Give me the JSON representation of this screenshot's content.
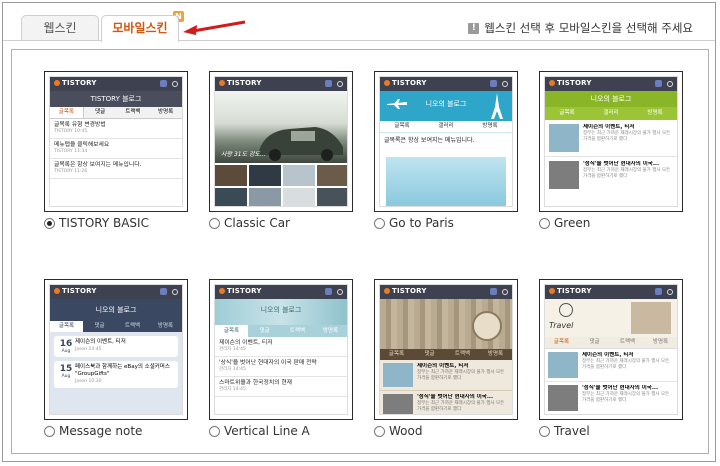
{
  "tabs": [
    {
      "label": "웹스킨",
      "active": false
    },
    {
      "label": "모바일스킨",
      "active": true
    }
  ],
  "new_badge": "N",
  "notice": {
    "icon": "exclamation-icon",
    "text": "웹스킨 선택 후 모바일스킨을 선택해 주세요"
  },
  "selected_skin": "TISTORY BASIC",
  "skins": [
    {
      "name": "TISTORY BASIC",
      "selected": true
    },
    {
      "name": "Classic Car",
      "selected": false
    },
    {
      "name": "Go to Paris",
      "selected": false
    },
    {
      "name": "Green",
      "selected": false
    },
    {
      "name": "Message note",
      "selected": false
    },
    {
      "name": "Vertical Line A",
      "selected": false
    },
    {
      "name": "Wood",
      "selected": false
    },
    {
      "name": "Travel",
      "selected": false
    }
  ],
  "previews": {
    "brand": "TISTORY",
    "blog_title_basic": "TISTORY 블로그",
    "blog_title": "니오의 블로그",
    "tabs_basic": [
      "글목록",
      "댓글",
      "트랙백",
      "방명록"
    ],
    "tabs_paris": [
      "글목록",
      "갤러리",
      "방명록"
    ],
    "tabs_green": [
      "글목록",
      "갤러리",
      "방명록"
    ],
    "basic_rows": [
      {
        "text": "글목록 유형 변경방법",
        "meta": "TISTORY 10:45"
      },
      {
        "text": "메뉴탭을 클릭해보세요",
        "meta": "TISTORY 11:34"
      },
      {
        "text": "글목록은 항상 보여지는 메뉴입니다.",
        "meta": "TISTORY 11:26"
      }
    ],
    "car_caption": "사랑 31도 강도...",
    "paris_text": "글목록은 항상 보여지는 메뉴입니다.",
    "green_rows": [
      {
        "title": "제이슨의 이벤트, 티저",
        "desc": "정부는 최근 가까운 재래시장의 물가 행사 모든 가격을 합판하기로 했다"
      },
      {
        "title": "'성식'을 벗어난 현대자의 이국...",
        "desc": "정부는 최근 가까운 재래시장의 물가 행사 모든 가격을 합판하기로 했다"
      }
    ],
    "message_rows": [
      {
        "day": "16",
        "month": "Aug",
        "text": "제이슨의 이벤트, 티저",
        "meta": "Jason 14:45"
      },
      {
        "day": "15",
        "month": "Aug",
        "text": "페이스북과 함께하는 eBay의 소셜커머스 \"GroupGifts\"",
        "meta": "Jason 10:30"
      }
    ],
    "vertical_rows": [
      {
        "text": "제이슨의 이벤트, 티저",
        "meta": "관리자 14:45"
      },
      {
        "text": "'상식'을 벗어난 현대자의 이국 판매 전략",
        "meta": "관리자 14:45"
      },
      {
        "text": "스마트위을과 한국정치의 현재",
        "meta": "관리자 14:45"
      }
    ],
    "wood_rows": [
      {
        "title": "제이슨의 이벤트, 티저",
        "desc": "정부는 최근 가까운 재래시장의 물가 행사 모든 가격을 합판하기로 했다"
      },
      {
        "title": "'성식'을 벗어난 현대자의 이국...",
        "desc": "정부는 최근 가까운 재래시장의 물가 행사 모든 가격을 합판하기로 했다"
      }
    ],
    "travel_header": "Travel",
    "travel_rows": [
      {
        "title": "제이슨의 이벤트, 티저",
        "desc": "정부는 최근 가까운 재래시장의 물가 행사 모든 가격을 합판하기로 했다"
      },
      {
        "title": "'성식'을 벗어난 현대자의 이국...",
        "desc": "정부는 최근 가까운 재래시장의 물가 행사 모든 가격을 합판하기로 했다"
      }
    ]
  },
  "colors": {
    "accent": "#d6550a",
    "arrow": "#d21c1c",
    "topbar": "#3e4250",
    "green": "#8ab526",
    "paris": "#2ea6c9",
    "wood": "#8a7a60"
  }
}
